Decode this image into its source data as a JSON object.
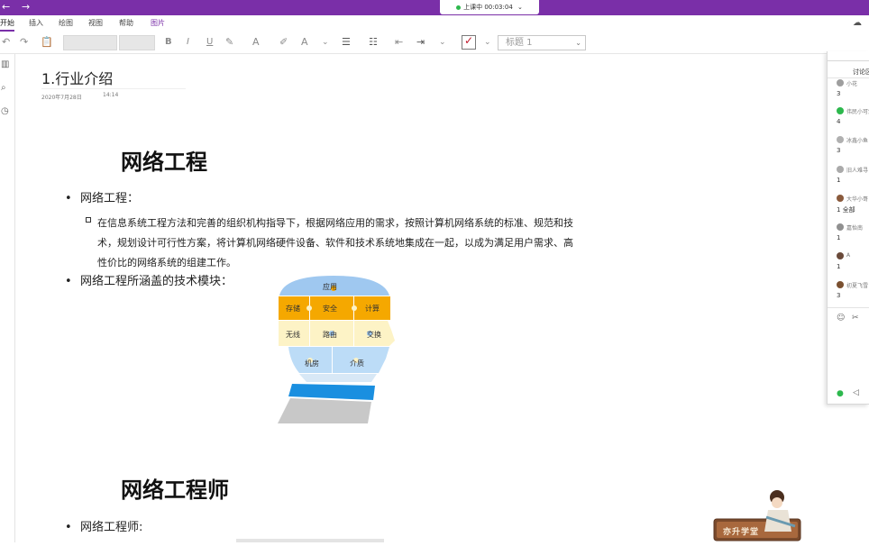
{
  "titlebar": {
    "back_glyph": "←",
    "forward_glyph": "→",
    "recording_label": "上课中 00:03:04",
    "recording_chevron": "⌄",
    "accent_color": "#7a2fa8"
  },
  "ribbon": {
    "tabs": [
      {
        "label": "开始"
      },
      {
        "label": "插入"
      },
      {
        "label": "绘图"
      },
      {
        "label": "视图"
      },
      {
        "label": "帮助"
      },
      {
        "label": "图片"
      }
    ],
    "right_icon": "share-icon"
  },
  "toolbar": {
    "style_value": "标题 1",
    "icons": [
      "undo-icon",
      "redo-icon",
      "clipboard-icon",
      "bold-icon",
      "italic-icon",
      "underline-icon",
      "highlight-icon",
      "font-color-icon",
      "clear-format-icon",
      "text-style-icon",
      "bullet-list-icon",
      "numbered-list-icon",
      "outdent-icon",
      "indent-icon",
      "todo-checkbox-icon"
    ],
    "bold": "B",
    "italic": "I",
    "underline": "U"
  },
  "page": {
    "title": "1.行业介绍",
    "date": "2020年7月28日",
    "time": "14:14",
    "section1": {
      "heading": "网络工程",
      "bullet1": "网络工程：",
      "sub_bullet": "在信息系统工程方法和完善的组织机构指导下，根据网络应用的需求，按照计算机网络系统的标准、规范和技术，规划设计可行性方案，将计算机网络硬件设备、软件和技术系统地集成在一起，以成为满足用户需求、高性价比的网络系统的组建工作。",
      "bullet2": "网络工程所涵盖的技术模块："
    },
    "diagram": {
      "labels": {
        "app": "应用",
        "storage": "存储",
        "security": "安全",
        "compute": "计算",
        "wireless": "无线",
        "routing": "路由",
        "switching": "交换",
        "datacenter": "机房",
        "media": "介质"
      },
      "colors": {
        "blue": "#9fc8f0",
        "orange": "#f5a800",
        "cream": "#fdf3c6",
        "light_blue": "#bcdcf7",
        "collar_blue": "#1a8fe0",
        "neck_gray": "#c8c8c8"
      }
    },
    "section2": {
      "heading": "网络工程师",
      "bullet1": "网络工程师:"
    }
  },
  "right_panel": {
    "title": "讨论区",
    "items": [
      {
        "name": "小花",
        "count": "3",
        "color": "#9e9e9e"
      },
      {
        "name": "伟民小可爱",
        "count": "4",
        "color": "#2db84d"
      },
      {
        "name": "冰鑫小鱼",
        "count": "3",
        "color": "#b0b0b0"
      },
      {
        "name": "旧人难寻",
        "count": "1",
        "color": "#aaaaaa"
      },
      {
        "name": "大华小哥",
        "count": "1 全部",
        "color": "#8a5a3c"
      },
      {
        "name": "嘉怡南",
        "count": "1",
        "color": "#909090"
      },
      {
        "name": "A",
        "count": "1",
        "color": "#6a4a3a"
      },
      {
        "name": "初夏飞雪",
        "count": "3",
        "color": "#7a5030"
      }
    ],
    "tools": [
      "emoji-icon",
      "scissors-icon",
      "more-icon",
      "mic-icon",
      "speaker-icon"
    ]
  },
  "sticker": {
    "text": "亦升学堂"
  }
}
